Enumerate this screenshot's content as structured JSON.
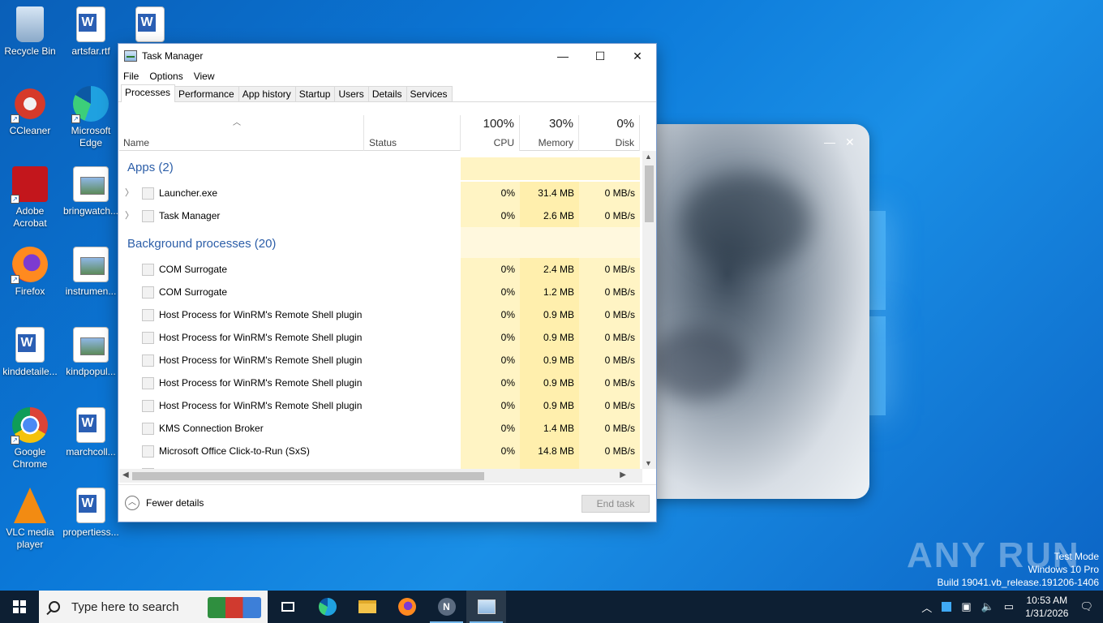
{
  "desktop": {
    "icons": [
      {
        "label": "Recycle Bin"
      },
      {
        "label": "CCleaner"
      },
      {
        "label": "Adobe Acrobat"
      },
      {
        "label": "Firefox"
      },
      {
        "label": "kinddetaile..."
      },
      {
        "label": "Google Chrome"
      },
      {
        "label": "VLC media player"
      },
      {
        "label": "artsfar.rtf"
      },
      {
        "label": "Microsoft Edge"
      },
      {
        "label": "bringwatch..."
      },
      {
        "label": "instrumen..."
      },
      {
        "label": "kindpopul..."
      },
      {
        "label": "marchcoll..."
      },
      {
        "label": "propertiess..."
      }
    ],
    "watermark": "ANY RUN",
    "sysinfo": {
      "line1": "Test Mode",
      "line2": "Windows 10 Pro",
      "line3": "Build 19041.vb_release.191206-1406"
    }
  },
  "taskmanager": {
    "title": "Task Manager",
    "window_controls": {
      "minimize": "—",
      "maximize": "☐",
      "close": "✕"
    },
    "menu": [
      "File",
      "Options",
      "View"
    ],
    "tabs": [
      "Processes",
      "Performance",
      "App history",
      "Startup",
      "Users",
      "Details",
      "Services"
    ],
    "active_tab": "Processes",
    "columns": {
      "name": "Name",
      "status": "Status",
      "cpu": {
        "pct": "100%",
        "label": "CPU"
      },
      "memory": {
        "pct": "30%",
        "label": "Memory"
      },
      "disk": {
        "pct": "0%",
        "label": "Disk"
      }
    },
    "groups": {
      "apps": "Apps (2)",
      "background": "Background processes (20)"
    },
    "apps": [
      {
        "name": "Launcher.exe",
        "cpu": "0%",
        "mem": "31.4 MB",
        "disk": "0 MB/s"
      },
      {
        "name": "Task Manager",
        "cpu": "0%",
        "mem": "2.6 MB",
        "disk": "0 MB/s"
      }
    ],
    "background": [
      {
        "name": "COM Surrogate",
        "cpu": "0%",
        "mem": "2.4 MB",
        "disk": "0 MB/s"
      },
      {
        "name": "COM Surrogate",
        "cpu": "0%",
        "mem": "1.2 MB",
        "disk": "0 MB/s"
      },
      {
        "name": "Host Process for WinRM's Remote Shell plugin",
        "cpu": "0%",
        "mem": "0.9 MB",
        "disk": "0 MB/s"
      },
      {
        "name": "Host Process for WinRM's Remote Shell plugin",
        "cpu": "0%",
        "mem": "0.9 MB",
        "disk": "0 MB/s"
      },
      {
        "name": "Host Process for WinRM's Remote Shell plugin",
        "cpu": "0%",
        "mem": "0.9 MB",
        "disk": "0 MB/s"
      },
      {
        "name": "Host Process for WinRM's Remote Shell plugin",
        "cpu": "0%",
        "mem": "0.9 MB",
        "disk": "0 MB/s"
      },
      {
        "name": "Host Process for WinRM's Remote Shell plugin",
        "cpu": "0%",
        "mem": "0.9 MB",
        "disk": "0 MB/s"
      },
      {
        "name": "KMS Connection Broker",
        "cpu": "0%",
        "mem": "1.4 MB",
        "disk": "0 MB/s"
      },
      {
        "name": "Microsoft Office Click-to-Run (SxS)",
        "cpu": "0%",
        "mem": "14.8 MB",
        "disk": "0 MB/s"
      }
    ],
    "footer": {
      "fewer_details": "Fewer details",
      "end_task": "End task"
    }
  },
  "taskbar": {
    "search_placeholder": "Type here to search",
    "clock_time": "10:53 AM",
    "clock_date": "1/31/2026"
  }
}
